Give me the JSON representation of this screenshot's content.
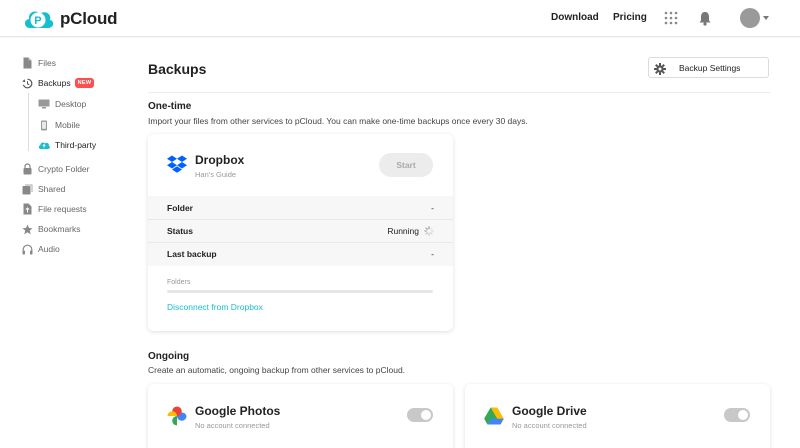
{
  "app": {
    "logo_text": "pCloud"
  },
  "header": {
    "nav": [
      {
        "label": "Download"
      },
      {
        "label": "Pricing"
      }
    ],
    "icons": [
      "apps-grid-icon",
      "bell-icon",
      "avatar",
      "chevron-down-icon"
    ]
  },
  "sidebar": {
    "items": [
      {
        "label": "Files",
        "icon": "file-icon"
      },
      {
        "label": "Backups",
        "icon": "backup-icon",
        "badge": "NEW"
      },
      {
        "label": "Crypto Folder",
        "icon": "lock-icon"
      },
      {
        "label": "Shared",
        "icon": "shared-icon"
      },
      {
        "label": "File requests",
        "icon": "file-request-icon"
      },
      {
        "label": "Bookmarks",
        "icon": "star-icon"
      },
      {
        "label": "Audio",
        "icon": "headphones-icon"
      }
    ],
    "sub_items": [
      {
        "label": "Desktop",
        "icon": "monitor-icon"
      },
      {
        "label": "Mobile",
        "icon": "phone-icon"
      },
      {
        "label": "Third-party",
        "icon": "cloud-icon"
      }
    ]
  },
  "main": {
    "title": "Backups",
    "settings_button": "Backup Settings",
    "one_time": {
      "title": "One-time",
      "description": "Import your files from other services to pCloud. You can make one-time backups once every 30 days.",
      "card": {
        "service": "Dropbox",
        "account": "Han's Guide",
        "start_label": "Start",
        "rows": [
          {
            "label": "Folder",
            "value": "-"
          },
          {
            "label": "Status",
            "value": "Running"
          },
          {
            "label": "Last backup",
            "value": "-"
          }
        ],
        "folders_label": "Folders",
        "progress": 0,
        "disconnect_label": "Disconnect from Dropbox"
      }
    },
    "ongoing": {
      "title": "Ongoing",
      "description": "Create an automatic, ongoing backup from other services to pCloud.",
      "cards": [
        {
          "service": "Google Photos",
          "status": "No account connected",
          "enabled": false
        },
        {
          "service": "Google Drive",
          "status": "No account connected",
          "enabled": false
        }
      ]
    }
  },
  "colors": {
    "accent": "#17bed0",
    "badge": "#ff4e4e",
    "dropbox": "#0061fe"
  }
}
